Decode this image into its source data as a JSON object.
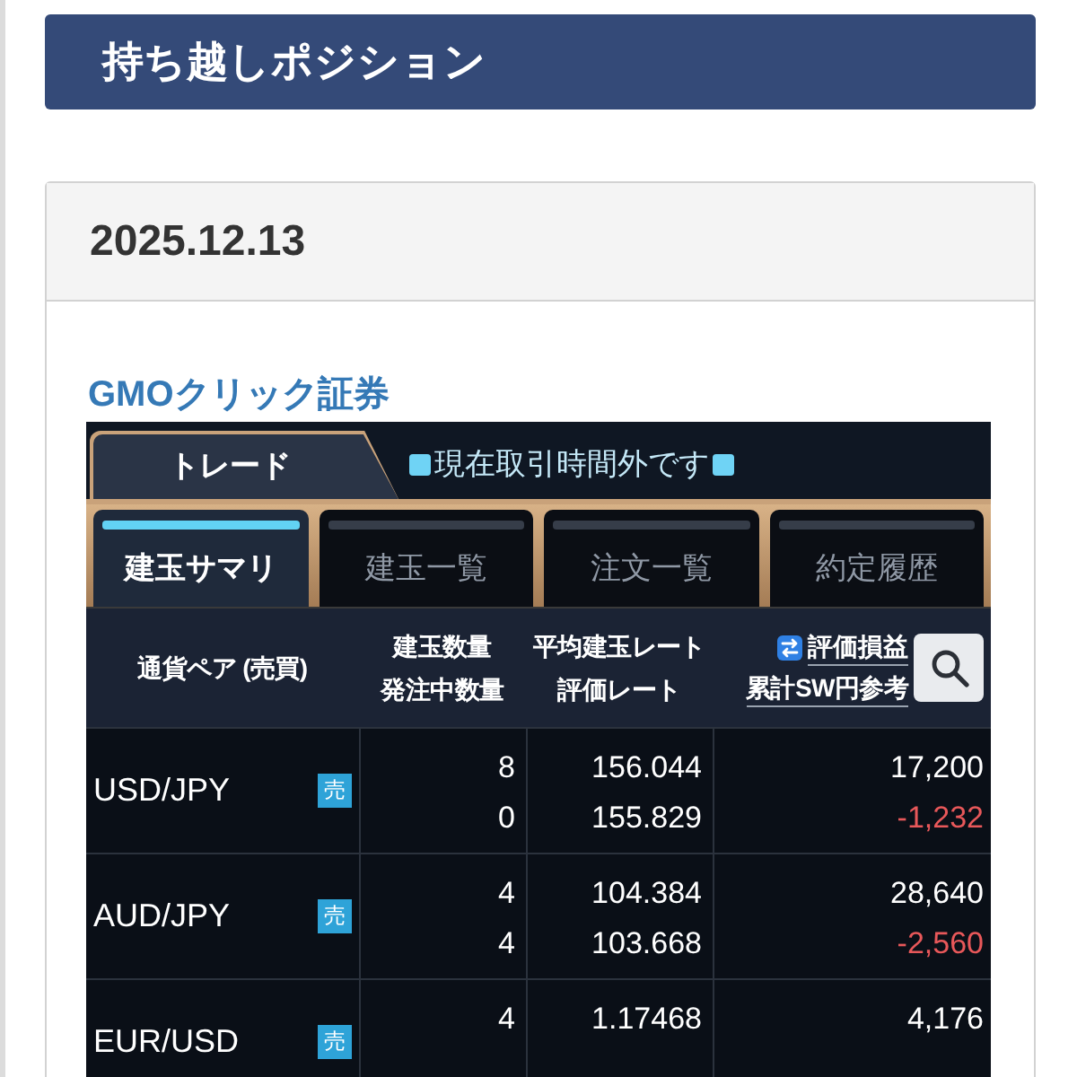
{
  "page_header": {
    "title": "持ち越しポジション"
  },
  "card": {
    "date": "2025.12.13",
    "broker": "GMOクリック証券"
  },
  "app": {
    "main_tab": "トレード",
    "status_message": "現在取引時間外です",
    "tabs": [
      {
        "label": "建玉サマリ",
        "selected": true
      },
      {
        "label": "建玉一覧",
        "selected": false
      },
      {
        "label": "注文一覧",
        "selected": false
      },
      {
        "label": "約定履歴",
        "selected": false
      }
    ],
    "table": {
      "columns": [
        {
          "kind": "plain",
          "lines": [
            "通貨ペア (売買)"
          ]
        },
        {
          "kind": "plain",
          "lines": [
            "建玉数量",
            "発注中数量"
          ]
        },
        {
          "kind": "plain",
          "lines": [
            "平均建玉レート",
            "評価レート"
          ]
        },
        {
          "kind": "toggle",
          "lines": [
            "評価損益",
            "累計SW円参考"
          ]
        }
      ],
      "rows": [
        {
          "pair": "USD/JPY",
          "side": "売",
          "quantity": "8",
          "pending": "0",
          "avg_rate": "156.044",
          "eval_rate": "155.829",
          "profit": {
            "text": "17,200",
            "loss": false
          },
          "swap": {
            "text": "-1,232",
            "loss": true
          }
        },
        {
          "pair": "AUD/JPY",
          "side": "売",
          "quantity": "4",
          "pending": "4",
          "avg_rate": "104.384",
          "eval_rate": "103.668",
          "profit": {
            "text": "28,640",
            "loss": false
          },
          "swap": {
            "text": "-2,560",
            "loss": true
          }
        },
        {
          "pair": "EUR/USD",
          "side": "売",
          "quantity": "4",
          "avg_rate": "1.17468",
          "profit": {
            "text": "4,176",
            "loss": false
          }
        }
      ]
    }
  }
}
